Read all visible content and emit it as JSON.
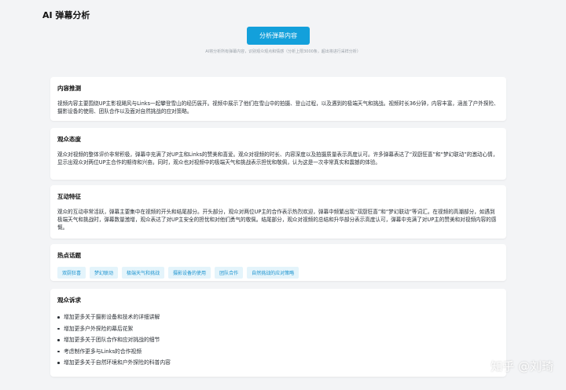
{
  "header": {
    "title": "AI 弹幕分析"
  },
  "toolbar": {
    "analyze_label": "分析弹幕内容",
    "hint": "AI将分析所有弹幕内容，识别观众观点和情感（分析上限3000条，超出将进行采样分析）"
  },
  "sections": {
    "content": {
      "title": "内容推测",
      "body": "视频内容主要围绕UP主影视飓风与Links一起攀登雪山的经历展开。视频中展示了他们在雪山中的拍摄、登山过程，以及遇到的极端天气和挑战。视频时长36分钟，内容丰富，涵盖了户外探险、摄影设备的使用、团队合作以及面对自然挑战的应对策略。"
    },
    "attitude": {
      "title": "观众态度",
      "body": "观众对视频的整体评价非常积极，弹幕中充满了对UP主和Links的赞美和喜爱。观众对视频的时长、内容深度以及拍摄质量表示高度认可。许多弹幕表达了“双厨狂喜”和“梦幻联动”的激动心情，显示出观众对两位UP主合作的期待和兴奋。同时，观众也对视频中的极端天气和挑战表示担忧和敬佩，认为这是一次非常真实和震撼的体验。"
    },
    "interaction": {
      "title": "互动特征",
      "body": "观众的互动非常活跃，弹幕主要集中在视频的开头和结尾部分。开头部分，观众对两位UP主的合作表示热烈欢迎，弹幕中频繁出现“双厨狂喜”和“梦幻联动”等词汇。在视频的高潮部分，如遇到极端天气和挑战时，弹幕数量激增，观众表达了对UP主安全的担忧和对他们勇气的敬佩。结尾部分，观众对视频的总结和升华部分表示高度认可，弹幕中充满了对UP主的赞美和对视频内容的感慨。"
    },
    "topics": {
      "title": "热点话题",
      "tags": [
        "双厨狂喜",
        "梦幻联动",
        "极端天气和挑战",
        "摄影设备的使用",
        "团队合作",
        "自然挑战的应对策略"
      ]
    },
    "demands": {
      "title": "观众诉求",
      "items": [
        "增加更多关于摄影设备和技术的详细讲解",
        "增加更多户外探险的幕后花絮",
        "增加更多关于团队合作和应对挑战的细节",
        "考虑制作更多与Links的合作视频",
        "增加更多关于自然环境和户外探险的科普内容"
      ]
    }
  },
  "watermark": "知乎 @刘琦"
}
